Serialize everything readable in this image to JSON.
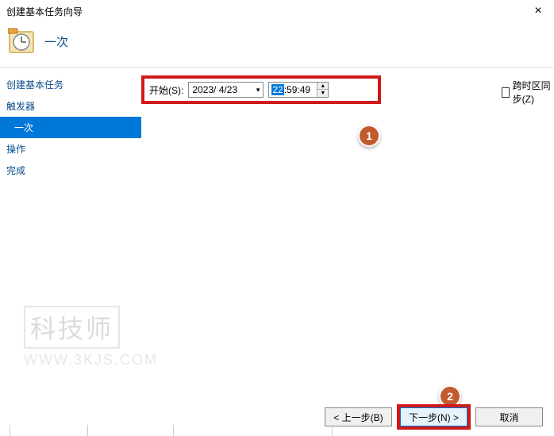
{
  "window": {
    "title": "创建基本任务向导",
    "close_icon": "×"
  },
  "header": {
    "title": "一次"
  },
  "sidebar": {
    "items": [
      {
        "label": "创建基本任务"
      },
      {
        "label": "触发器"
      },
      {
        "label": "一次"
      },
      {
        "label": "操作"
      },
      {
        "label": "完成"
      }
    ]
  },
  "content": {
    "start_label": "开始(S):",
    "date_value": "2023/ 4/23",
    "time_hour_selected": "22",
    "time_rest": ":59:49",
    "sync_label": "跨时区同步(Z)"
  },
  "annotations": {
    "badge1": "1",
    "badge2": "2"
  },
  "watermark": {
    "top": "科技师",
    "url": "WWW.3KJS.COM"
  },
  "footer": {
    "back": "< 上一步(B)",
    "next": "下一步(N) >",
    "cancel": "取消"
  }
}
